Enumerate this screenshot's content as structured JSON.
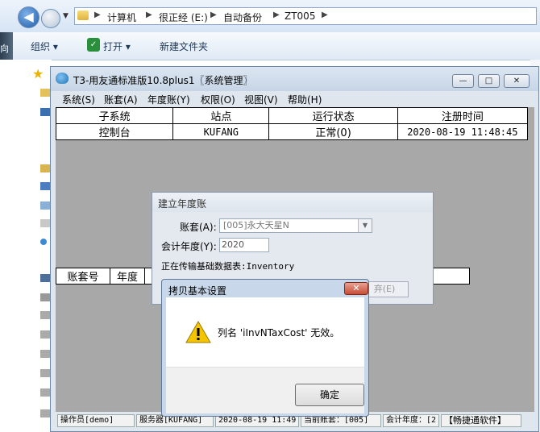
{
  "explorer": {
    "breadcrumbs": [
      "计算机",
      "很正经 (E:)",
      "自动备份",
      "ZT005"
    ],
    "toolbar": {
      "organize": "组织 ▾",
      "open": "打开 ▾",
      "new_folder": "新建文件夹"
    },
    "left_edge": [
      "向",
      "k",
      "an",
      "快"
    ]
  },
  "t3": {
    "title": "T3-用友通标准版10.8plus1〖系统管理〗",
    "menu": [
      "系统(S)",
      "账套(A)",
      "年度账(Y)",
      "权限(O)",
      "视图(V)",
      "帮助(H)"
    ],
    "subsystem_table": {
      "headers": [
        "子系统",
        "站点",
        "运行状态",
        "注册时间"
      ],
      "rows": [
        [
          "控制台",
          "KUFANG",
          "正常(0)",
          "2020-08-19 11:48:45"
        ]
      ]
    },
    "account_table": {
      "headers": [
        "账套号",
        "年度"
      ]
    },
    "status": [
      "操作员[demo]",
      "服务器[KUFANG]",
      "2020-08-19 11:49",
      "当前账套：[005]",
      "会计年度：[2",
      "【畅捷通软件】"
    ]
  },
  "year_dialog": {
    "title": "建立年度账",
    "account_label": "账套(A):",
    "account_value": "[005]永大天星N",
    "year_label": "会计年度(Y):",
    "year_value": "2020",
    "status_text": "正在传输基础数据表:Inventory",
    "cancel_label": "弃(E)"
  },
  "copy_dialog": {
    "title": "拷贝基本设置",
    "message": "列名 'iInvNTaxCost' 无效。",
    "ok_label": "确定",
    "close_label": "✕"
  }
}
